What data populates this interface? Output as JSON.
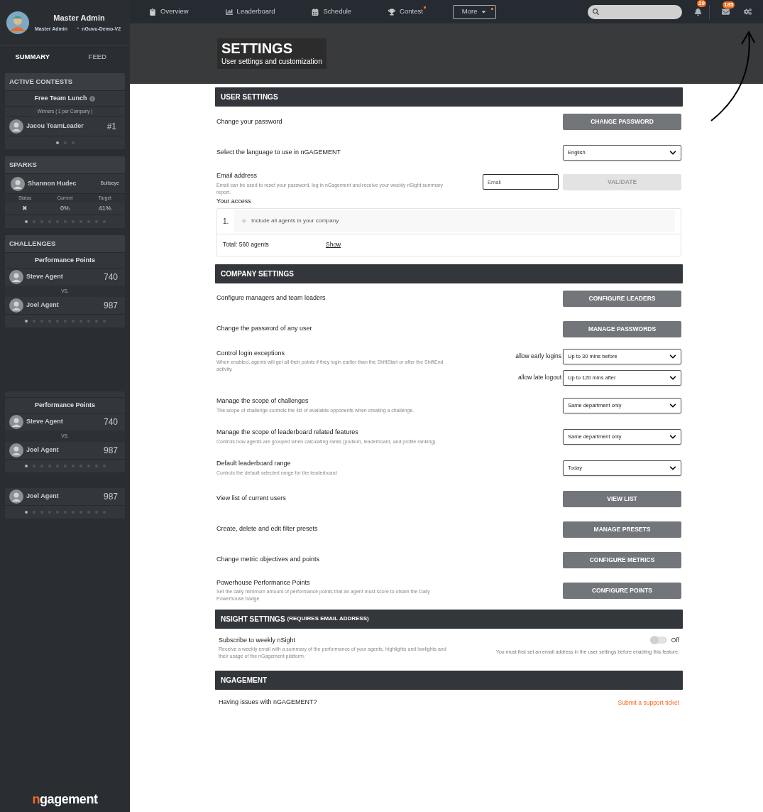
{
  "sidebar": {
    "profile": {
      "name": "Master Admin",
      "role": "Master Admin",
      "company_marker": "^",
      "company": "nGuvu-Demo-V2"
    },
    "tabs": [
      {
        "label": "SUMMARY",
        "selected": true
      },
      {
        "label": "FEED",
        "selected": false
      }
    ],
    "cards": [
      {
        "kind": "contest",
        "title": "ACTIVE CONTESTS",
        "name": "Free Team Lunch",
        "subtitle": "Winners ( 1 per Company )",
        "entries": [
          {
            "name": "Jacou TeamLeader",
            "value": "#1"
          }
        ],
        "dots": [
          {
            "selected": true
          },
          {
            "selected": false
          },
          {
            "selected": false
          }
        ]
      },
      {
        "kind": "sparks",
        "title": "SPARKS",
        "person": "Shannon Hudec",
        "tag": "Bullseye",
        "columns": [
          "Status",
          "Current",
          "Target"
        ],
        "values": [
          "✖",
          "0%",
          "41%"
        ],
        "dots": [
          {
            "selected": true
          },
          {
            "selected": false
          },
          {
            "selected": false
          },
          {
            "selected": false
          },
          {
            "selected": false
          },
          {
            "selected": false
          },
          {
            "selected": false
          },
          {
            "selected": false
          },
          {
            "selected": false
          },
          {
            "selected": false
          },
          {
            "selected": false
          }
        ]
      },
      {
        "kind": "challenge",
        "title": "CHALLENGES",
        "name": "Performance Points",
        "players": [
          {
            "name": "Steve Agent",
            "score": "740"
          },
          {
            "name": "Joel Agent",
            "score": "987"
          }
        ],
        "vs": "VS.",
        "dots": [
          {
            "selected": true
          },
          {
            "selected": false
          },
          {
            "selected": false
          },
          {
            "selected": false
          },
          {
            "selected": false
          },
          {
            "selected": false
          },
          {
            "selected": false
          },
          {
            "selected": false
          },
          {
            "selected": false
          },
          {
            "selected": false
          },
          {
            "selected": false
          }
        ]
      },
      {
        "kind": "challenge",
        "name": "Performance Points",
        "players": [
          {
            "name": "Steve Agent",
            "score": "740"
          },
          {
            "name": "Joel Agent",
            "score": "987"
          }
        ],
        "vs": "VS.",
        "dots": [
          {
            "selected": true
          },
          {
            "selected": false
          },
          {
            "selected": false
          },
          {
            "selected": false
          },
          {
            "selected": false
          },
          {
            "selected": false
          },
          {
            "selected": false
          },
          {
            "selected": false
          },
          {
            "selected": false
          },
          {
            "selected": false
          },
          {
            "selected": false
          }
        ]
      },
      {
        "kind": "challenge",
        "players": [
          {
            "name": "Joel Agent",
            "score": "987"
          }
        ],
        "dots": [
          {
            "selected": true
          },
          {
            "selected": false
          },
          {
            "selected": false
          },
          {
            "selected": false
          },
          {
            "selected": false
          },
          {
            "selected": false
          },
          {
            "selected": false
          },
          {
            "selected": false
          },
          {
            "selected": false
          },
          {
            "selected": false
          },
          {
            "selected": false
          }
        ]
      }
    ],
    "logo": {
      "accent": "n",
      "rest": "gagement"
    }
  },
  "nav": {
    "items": [
      {
        "label": "Overview",
        "dot": false
      },
      {
        "label": "Leaderboard",
        "dot": false
      },
      {
        "label": "Schedule",
        "dot": false
      },
      {
        "label": "Contest",
        "dot": true
      }
    ],
    "more": {
      "label": "More",
      "dot": true
    },
    "notifications": "29",
    "messages": "185"
  },
  "header": {
    "title": "SETTINGS",
    "subtitle": "User settings and customization"
  },
  "sections": [
    {
      "title": "USER SETTINGS",
      "rows": [
        {
          "kind": "button",
          "label": "Change your password",
          "button": "CHANGE PASSWORD"
        },
        {
          "kind": "select",
          "label": "Select the language to use in nGAGEMENT",
          "value": "English"
        },
        {
          "kind": "email",
          "label": "Email address",
          "description": "Email can be used to reset your password, log in nGagement and receive your weekly nSight summary report.",
          "placeholder": "Email",
          "button": "VALIDATE",
          "disabled": true
        },
        {
          "kind": "access",
          "label": "Your access",
          "items": [
            {
              "number": "1.",
              "text": "Include all agents in your company."
            }
          ],
          "total": "Total: 560 agents",
          "link": "Show"
        }
      ]
    },
    {
      "title": "COMPANY SETTINGS",
      "rows": [
        {
          "kind": "button",
          "label": "Configure managers and team leaders",
          "button": "CONFIGURE LEADERS"
        },
        {
          "kind": "button",
          "label": "Change the password of any user",
          "button": "MANAGE PASSWORDS"
        },
        {
          "kind": "multi_select",
          "label": "Control login exceptions",
          "description": "When enabled, agents will get all their points if they login earlier than the ShiftStart or after the ShiftEnd activity.",
          "selects": [
            {
              "label": "allow early logins",
              "value": "Up to 30 mins before"
            },
            {
              "label": "allow late logout",
              "value": "Up to 120 mins after"
            }
          ]
        },
        {
          "kind": "select",
          "label": "Manage the scope of challenges",
          "description": "The scope of challenge controls the list of available opponents when creating a challenge.",
          "value": "Same department only"
        },
        {
          "kind": "select",
          "label": "Manage the scope of leaderboard related features",
          "description": "Controls how agents are grouped when calculating ranks (podium, leaderboard, and profile ranking).",
          "value": "Same department only"
        },
        {
          "kind": "select",
          "label": "Default leaderboard range",
          "description": "Controls the default selected range for the leaderboard",
          "value": "Today"
        },
        {
          "kind": "button",
          "label": "View list of current users",
          "button": "VIEW LIST"
        },
        {
          "kind": "button",
          "label": "Create, delete and edit filter presets",
          "button": "MANAGE PRESETS"
        },
        {
          "kind": "button",
          "label": "Change metric objectives and points",
          "button": "CONFIGURE METRICS"
        },
        {
          "kind": "button",
          "label": "Powerhouse Performance Points",
          "description": "Set the daily minimum amount of performance points that an agent must score to obtain the Daily Powerhouse badge",
          "button": "CONFIGURE POINTS"
        }
      ]
    },
    {
      "title": "NSIGHT SETTINGS",
      "title_note": "(REQUIRES EMAIL ADDRESS)",
      "rows": [
        {
          "kind": "toggle",
          "label": "Subscribe to weekly nSight",
          "description": "Receive a weekly email with a summary of the performance of your agents, highlights and lowlights and their usage of the nGagement platform.",
          "on": false,
          "state_label": "Off",
          "note": "You must first set an email address in the user settings before enabling this feature."
        }
      ]
    },
    {
      "title": "NGAGEMENT",
      "rows": [
        {
          "kind": "link",
          "label": "Having issues with nGAGEMENT?",
          "link": "Submit a support ticket"
        }
      ]
    }
  ]
}
